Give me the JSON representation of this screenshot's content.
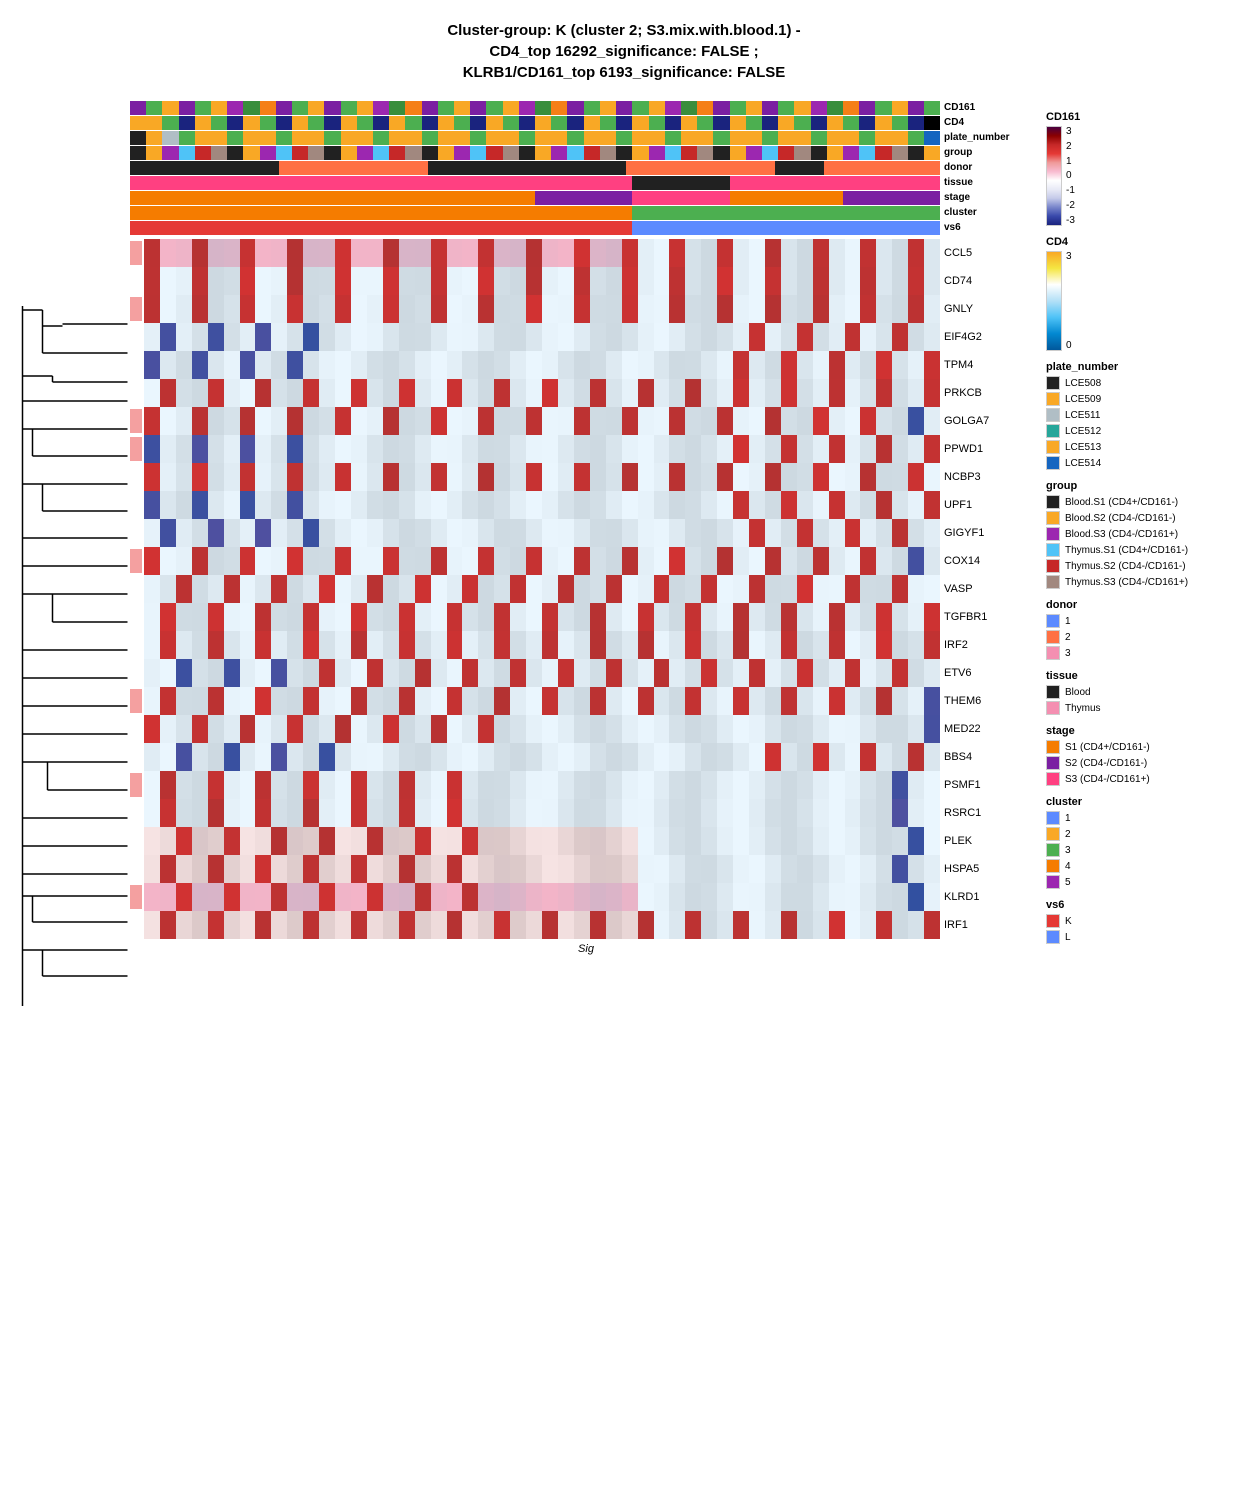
{
  "title": {
    "line1": "Cluster-group: K (cluster 2; S3.mix.with.blood.1) -",
    "line2": "CD4_top 16292_significance: FALSE ;",
    "line3": "KLRB1/CD161_top 6193_significance: FALSE"
  },
  "annotation_rows": [
    {
      "label": "CD161",
      "colors": [
        "#7b1fa2",
        "#4caf50",
        "#f9a825",
        "#7b1fa2",
        "#4caf50",
        "#f9a825",
        "#9c27b0",
        "#388e3c",
        "#f57f17",
        "#7b1fa2",
        "#4caf50",
        "#f9a825",
        "#7b1fa2",
        "#4caf50",
        "#f9a825",
        "#9c27b0",
        "#388e3c",
        "#f57f17",
        "#7b1fa2",
        "#4caf50",
        "#f9a825",
        "#7b1fa2",
        "#4caf50",
        "#f9a825",
        "#9c27b0",
        "#388e3c",
        "#f57f17",
        "#7b1fa2",
        "#4caf50",
        "#f9a825",
        "#7b1fa2",
        "#4caf50",
        "#f9a825",
        "#9c27b0",
        "#388e3c",
        "#f57f17",
        "#7b1fa2",
        "#4caf50",
        "#f9a825",
        "#7b1fa2",
        "#4caf50",
        "#f9a825",
        "#9c27b0",
        "#388e3c",
        "#f57f17",
        "#7b1fa2",
        "#4caf50",
        "#f9a825",
        "#7b1fa2",
        "#4caf50"
      ]
    },
    {
      "label": "CD4",
      "colors": [
        "#f9a825",
        "#f9a825",
        "#4caf50",
        "#1a237e",
        "#f9a825",
        "#4caf50",
        "#1a237e",
        "#f9a825",
        "#4caf50",
        "#1a237e",
        "#f9a825",
        "#4caf50",
        "#1a237e",
        "#f9a825",
        "#4caf50",
        "#1a237e",
        "#f9a825",
        "#4caf50",
        "#1a237e",
        "#f9a825",
        "#4caf50",
        "#1a237e",
        "#f9a825",
        "#4caf50",
        "#1a237e",
        "#f9a825",
        "#4caf50",
        "#1a237e",
        "#f9a825",
        "#4caf50",
        "#1a237e",
        "#f9a825",
        "#4caf50",
        "#1a237e",
        "#f9a825",
        "#4caf50",
        "#1a237e",
        "#f9a825",
        "#4caf50",
        "#1a237e",
        "#f9a825",
        "#4caf50",
        "#1a237e",
        "#f9a825",
        "#4caf50",
        "#1a237e",
        "#f9a825",
        "#4caf50",
        "#1a237e",
        "#000000"
      ]
    },
    {
      "label": "plate_number",
      "colors": [
        "#212121",
        "#f9a825",
        "#b0bec5",
        "#4caf50",
        "#f9a825",
        "#f9a825",
        "#4caf50",
        "#f9a825",
        "#f9a825",
        "#4caf50",
        "#f9a825",
        "#f9a825",
        "#4caf50",
        "#f9a825",
        "#f9a825",
        "#4caf50",
        "#f9a825",
        "#f9a825",
        "#4caf50",
        "#f9a825",
        "#f9a825",
        "#4caf50",
        "#f9a825",
        "#f9a825",
        "#4caf50",
        "#f9a825",
        "#f9a825",
        "#4caf50",
        "#f9a825",
        "#f9a825",
        "#4caf50",
        "#f9a825",
        "#f9a825",
        "#4caf50",
        "#f9a825",
        "#f9a825",
        "#4caf50",
        "#f9a825",
        "#f9a825",
        "#4caf50",
        "#f9a825",
        "#f9a825",
        "#4caf50",
        "#f9a825",
        "#f9a825",
        "#4caf50",
        "#f9a825",
        "#f9a825",
        "#4caf50",
        "#1565c0"
      ]
    },
    {
      "label": "group",
      "colors": [
        "#212121",
        "#f9a825",
        "#9c27b0",
        "#4fc3f7",
        "#c62828",
        "#a1887f",
        "#212121",
        "#f9a825",
        "#9c27b0",
        "#4fc3f7",
        "#c62828",
        "#a1887f",
        "#212121",
        "#f9a825",
        "#9c27b0",
        "#4fc3f7",
        "#c62828",
        "#a1887f",
        "#212121",
        "#f9a825",
        "#9c27b0",
        "#4fc3f7",
        "#c62828",
        "#a1887f",
        "#212121",
        "#f9a825",
        "#9c27b0",
        "#4fc3f7",
        "#c62828",
        "#a1887f",
        "#212121",
        "#f9a825",
        "#9c27b0",
        "#4fc3f7",
        "#c62828",
        "#a1887f",
        "#212121",
        "#f9a825",
        "#9c27b0",
        "#4fc3f7",
        "#c62828",
        "#a1887f",
        "#212121",
        "#f9a825",
        "#9c27b0",
        "#4fc3f7",
        "#c62828",
        "#a1887f",
        "#212121",
        "#f9a825"
      ]
    },
    {
      "label": "donor",
      "colors": [
        "#212121",
        "#212121",
        "#212121",
        "#212121",
        "#212121",
        "#212121",
        "#212121",
        "#212121",
        "#212121",
        "#ff7043",
        "#ff7043",
        "#ff7043",
        "#ff7043",
        "#ff7043",
        "#ff7043",
        "#ff7043",
        "#ff7043",
        "#ff7043",
        "#212121",
        "#212121",
        "#212121",
        "#212121",
        "#212121",
        "#212121",
        "#212121",
        "#212121",
        "#212121",
        "#212121",
        "#212121",
        "#212121",
        "#ff7043",
        "#ff7043",
        "#ff7043",
        "#ff7043",
        "#ff7043",
        "#ff7043",
        "#ff7043",
        "#ff7043",
        "#ff7043",
        "#212121",
        "#212121",
        "#212121",
        "#ff7043",
        "#ff7043",
        "#ff7043",
        "#ff7043",
        "#ff7043",
        "#ff7043",
        "#ff7043"
      ]
    },
    {
      "label": "tissue",
      "colors": [
        "#ff4081",
        "#ff4081",
        "#ff4081",
        "#ff4081",
        "#ff4081",
        "#ff4081",
        "#ff4081",
        "#ff4081",
        "#ff4081",
        "#ff4081",
        "#ff4081",
        "#ff4081",
        "#ff4081",
        "#ff4081",
        "#ff4081",
        "#ff4081",
        "#ff4081",
        "#ff4081",
        "#ff4081",
        "#ff4081",
        "#ff4081",
        "#ff4081",
        "#ff4081",
        "#ff4081",
        "#ff4081",
        "#ff4081",
        "#ff4081",
        "#ff4081",
        "#ff4081",
        "#ff4081",
        "#ff4081",
        "#212121",
        "#212121",
        "#212121",
        "#212121",
        "#212121",
        "#212121",
        "#ff4081",
        "#ff4081",
        "#ff4081",
        "#ff4081",
        "#ff4081",
        "#ff4081",
        "#ff4081",
        "#ff4081",
        "#ff4081",
        "#ff4081",
        "#ff4081",
        "#ff4081",
        "#ff4081"
      ]
    },
    {
      "label": "stage",
      "colors": [
        "#f57c00",
        "#f57c00",
        "#f57c00",
        "#f57c00",
        "#f57c00",
        "#f57c00",
        "#f57c00",
        "#f57c00",
        "#f57c00",
        "#f57c00",
        "#f57c00",
        "#f57c00",
        "#f57c00",
        "#f57c00",
        "#f57c00",
        "#f57c00",
        "#f57c00",
        "#f57c00",
        "#f57c00",
        "#f57c00",
        "#f57c00",
        "#f57c00",
        "#f57c00",
        "#f57c00",
        "#f57c00",
        "#7b1fa2",
        "#7b1fa2",
        "#7b1fa2",
        "#7b1fa2",
        "#7b1fa2",
        "#7b1fa2",
        "#ff4081",
        "#ff4081",
        "#ff4081",
        "#ff4081",
        "#ff4081",
        "#ff4081",
        "#f57c00",
        "#f57c00",
        "#f57c00",
        "#f57c00",
        "#f57c00",
        "#f57c00",
        "#f57c00",
        "#7b1fa2",
        "#7b1fa2",
        "#7b1fa2",
        "#7b1fa2",
        "#7b1fa2",
        "#7b1fa2"
      ]
    },
    {
      "label": "cluster",
      "colors": [
        "#f57c00",
        "#f57c00",
        "#f57c00",
        "#f57c00",
        "#f57c00",
        "#f57c00",
        "#f57c00",
        "#f57c00",
        "#f57c00",
        "#f57c00",
        "#f57c00",
        "#f57c00",
        "#f57c00",
        "#f57c00",
        "#f57c00",
        "#f57c00",
        "#f57c00",
        "#f57c00",
        "#f57c00",
        "#f57c00",
        "#f57c00",
        "#f57c00",
        "#f57c00",
        "#f57c00",
        "#f57c00",
        "#f57c00",
        "#f57c00",
        "#f57c00",
        "#f57c00",
        "#f57c00",
        "#f57c00",
        "#4caf50",
        "#4caf50",
        "#4caf50",
        "#4caf50",
        "#4caf50",
        "#4caf50",
        "#4caf50",
        "#4caf50",
        "#4caf50",
        "#4caf50",
        "#4caf50",
        "#4caf50",
        "#4caf50",
        "#4caf50",
        "#4caf50",
        "#4caf50",
        "#4caf50",
        "#4caf50",
        "#4caf50"
      ]
    },
    {
      "label": "vs6",
      "colors": [
        "#e53935",
        "#e53935",
        "#e53935",
        "#e53935",
        "#e53935",
        "#e53935",
        "#e53935",
        "#e53935",
        "#e53935",
        "#e53935",
        "#e53935",
        "#e53935",
        "#e53935",
        "#e53935",
        "#e53935",
        "#e53935",
        "#e53935",
        "#e53935",
        "#e53935",
        "#e53935",
        "#e53935",
        "#e53935",
        "#e53935",
        "#e53935",
        "#e53935",
        "#e53935",
        "#e53935",
        "#e53935",
        "#e53935",
        "#e53935",
        "#e53935",
        "#5c8aff",
        "#5c8aff",
        "#5c8aff",
        "#5c8aff",
        "#5c8aff",
        "#5c8aff",
        "#5c8aff",
        "#5c8aff",
        "#5c8aff",
        "#5c8aff",
        "#5c8aff",
        "#5c8aff",
        "#5c8aff",
        "#5c8aff",
        "#5c8aff",
        "#5c8aff",
        "#5c8aff",
        "#5c8aff",
        "#5c8aff"
      ]
    }
  ],
  "heatmap_genes": [
    {
      "name": "CCL5",
      "sig": true,
      "base_color": "#e8d5d5"
    },
    {
      "name": "CD74",
      "sig": false,
      "base_color": "#dce8f0"
    },
    {
      "name": "GNLY",
      "sig": true,
      "base_color": "#dce8f0"
    },
    {
      "name": "EIF4G2",
      "sig": false,
      "base_color": "#dce8f0"
    },
    {
      "name": "TPM4",
      "sig": false,
      "base_color": "#dce8f0"
    },
    {
      "name": "PRKCB",
      "sig": false,
      "base_color": "#dce8f0"
    },
    {
      "name": "GOLGA7",
      "sig": true,
      "base_color": "#dce8f0"
    },
    {
      "name": "PPWD1",
      "sig": true,
      "base_color": "#dce8f0"
    },
    {
      "name": "NCBP3",
      "sig": false,
      "base_color": "#dce8f0"
    },
    {
      "name": "UPF1",
      "sig": false,
      "base_color": "#dce8f0"
    },
    {
      "name": "GIGYF1",
      "sig": false,
      "base_color": "#dce8f0"
    },
    {
      "name": "COX14",
      "sig": true,
      "base_color": "#dce8f0"
    },
    {
      "name": "VASP",
      "sig": false,
      "base_color": "#dce8f0"
    },
    {
      "name": "TGFBR1",
      "sig": false,
      "base_color": "#dce8f0"
    },
    {
      "name": "IRF2",
      "sig": false,
      "base_color": "#dce8f0"
    },
    {
      "name": "ETV6",
      "sig": false,
      "base_color": "#dce8f0"
    },
    {
      "name": "THEM6",
      "sig": true,
      "base_color": "#dce8f0"
    },
    {
      "name": "MED22",
      "sig": false,
      "base_color": "#dce8f0"
    },
    {
      "name": "BBS4",
      "sig": false,
      "base_color": "#dce8f0"
    },
    {
      "name": "PSMF1",
      "sig": true,
      "base_color": "#dce8f0"
    },
    {
      "name": "RSRC1",
      "sig": false,
      "base_color": "#dce8f0"
    },
    {
      "name": "PLEK",
      "sig": false,
      "base_color": "#e8d5d5"
    },
    {
      "name": "HSPA5",
      "sig": false,
      "base_color": "#e8d5d5"
    },
    {
      "name": "KLRD1",
      "sig": true,
      "base_color": "#e8d5d5"
    },
    {
      "name": "IRF1",
      "sig": false,
      "base_color": "#e8d5d5"
    }
  ],
  "legend": {
    "cd161_title": "CD161",
    "cd161_ticks": [
      "3",
      "2",
      "1",
      "0",
      "-1",
      "-2",
      "-3"
    ],
    "cd4_title": "CD4",
    "cd4_ticks": [
      "3",
      "0"
    ],
    "plate_number_title": "plate_number",
    "plate_numbers": [
      {
        "label": "LCE508",
        "color": "#212121"
      },
      {
        "label": "LCE509",
        "color": "#f9a825"
      },
      {
        "label": "LCE511",
        "color": "#b0bec5"
      },
      {
        "label": "LCE512",
        "color": "#26a69a"
      },
      {
        "label": "LCE513",
        "color": "#f9a825"
      },
      {
        "label": "LCE514",
        "color": "#1565c0"
      }
    ],
    "group_title": "group",
    "groups": [
      {
        "label": "Blood.S1 (CD4+/CD161-)",
        "color": "#212121"
      },
      {
        "label": "Blood.S2 (CD4-/CD161-)",
        "color": "#f9a825"
      },
      {
        "label": "Blood.S3 (CD4-/CD161+)",
        "color": "#9c27b0"
      },
      {
        "label": "Thymus.S1 (CD4+/CD161-)",
        "color": "#4fc3f7"
      },
      {
        "label": "Thymus.S2 (CD4-/CD161-)",
        "color": "#c62828"
      },
      {
        "label": "Thymus.S3 (CD4-/CD161+)",
        "color": "#a1887f"
      }
    ],
    "donor_title": "donor",
    "donors": [
      {
        "label": "1",
        "color": "#5c8aff"
      },
      {
        "label": "2",
        "color": "#ff7043"
      },
      {
        "label": "3",
        "color": "#f48fb1"
      }
    ],
    "tissue_title": "tissue",
    "tissues": [
      {
        "label": "Blood",
        "color": "#212121"
      },
      {
        "label": "Thymus",
        "color": "#f48fb1"
      }
    ],
    "stage_title": "stage",
    "stages": [
      {
        "label": "S1 (CD4+/CD161-)",
        "color": "#f57c00"
      },
      {
        "label": "S2 (CD4-/CD161-)",
        "color": "#7b1fa2"
      },
      {
        "label": "S3 (CD4-/CD161+)",
        "color": "#ff4081"
      }
    ],
    "cluster_title": "cluster",
    "clusters": [
      {
        "label": "1",
        "color": "#5c8aff"
      },
      {
        "label": "2",
        "color": "#f9a825"
      },
      {
        "label": "3",
        "color": "#4caf50"
      },
      {
        "label": "4",
        "color": "#f57c00"
      },
      {
        "label": "5",
        "color": "#9c27b0"
      }
    ],
    "vs6_title": "vs6",
    "vs6s": [
      {
        "label": "K",
        "color": "#e53935"
      },
      {
        "label": "L",
        "color": "#5c8aff"
      }
    ]
  },
  "x_axis_label": "Sig"
}
